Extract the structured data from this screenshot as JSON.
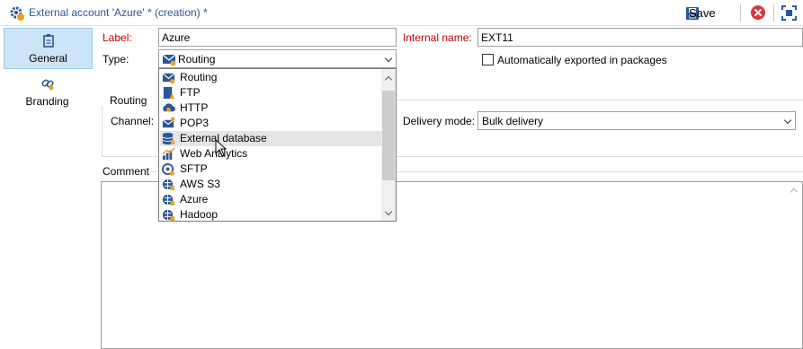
{
  "window": {
    "title": "External account 'Azure' * (creation) *",
    "save_label": "Save",
    "accent": "#2b5797",
    "close_icon": "close-icon",
    "fullscreen_icon": "fullscreen-icon"
  },
  "nav": {
    "items": [
      {
        "label": "General",
        "icon": "clipboard-icon",
        "active": true
      },
      {
        "label": "Branding",
        "icon": "link-icon",
        "active": false
      }
    ]
  },
  "form": {
    "label_label": "Label:",
    "label_value": "Azure",
    "internal_name_label": "Internal name:",
    "internal_name_value": "EXT11",
    "type_label": "Type:",
    "type_value": "Routing",
    "auto_export_label": "Automatically exported in packages",
    "auto_export_checked": false,
    "routing_group_label": "Routing",
    "channel_label": "Channel:",
    "delivery_mode_label": "Delivery mode:",
    "delivery_mode_value": "Bulk delivery",
    "comment_label": "Comment"
  },
  "type_dropdown": {
    "options": [
      {
        "label": "Routing",
        "icon": "routing-icon"
      },
      {
        "label": "FTP",
        "icon": "ftp-icon"
      },
      {
        "label": "HTTP",
        "icon": "http-icon"
      },
      {
        "label": "POP3",
        "icon": "pop3-icon"
      },
      {
        "label": "External database",
        "icon": "database-icon"
      },
      {
        "label": "Web Analytics",
        "icon": "web-analytics-icon"
      },
      {
        "label": "SFTP",
        "icon": "sftp-icon"
      },
      {
        "label": "AWS S3",
        "icon": "aws-s3-icon"
      },
      {
        "label": "Azure",
        "icon": "azure-icon"
      },
      {
        "label": "Hadoop",
        "icon": "hadoop-icon"
      }
    ],
    "hovered_index": 4
  }
}
